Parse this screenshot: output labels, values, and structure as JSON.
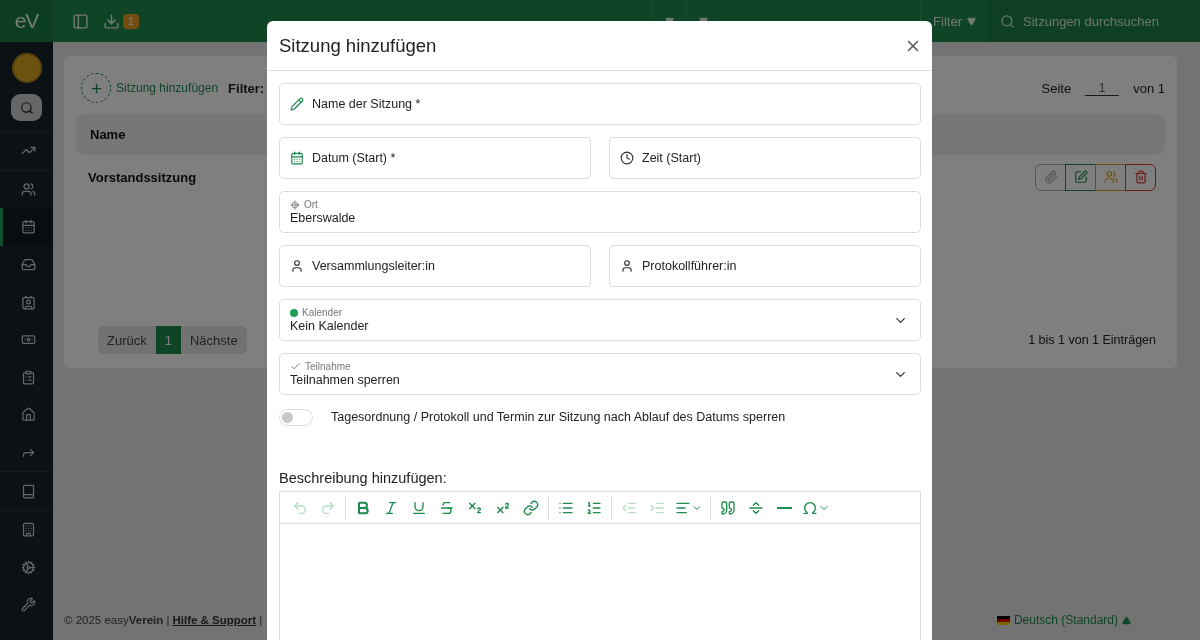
{
  "sidebar": {
    "logo": "eV",
    "items": [
      {
        "kind": "chart",
        "selected": false
      },
      {
        "kind": "users",
        "selected": false
      },
      {
        "kind": "calendar",
        "selected": true
      },
      {
        "kind": "inbox",
        "selected": false
      },
      {
        "kind": "contact",
        "selected": false
      },
      {
        "kind": "money",
        "selected": false
      },
      {
        "kind": "clipboard",
        "selected": false
      },
      {
        "kind": "home",
        "selected": false
      },
      {
        "kind": "share",
        "selected": false
      },
      {
        "kind": "book",
        "selected": false
      },
      {
        "kind": "building",
        "selected": false
      },
      {
        "kind": "cogs",
        "selected": false
      },
      {
        "kind": "wrench",
        "selected": false
      }
    ]
  },
  "topbar": {
    "badge": "1",
    "menus": [
      {
        "kind": "dropdown"
      },
      {
        "kind": "dropdown"
      },
      {
        "kind": "dropdown",
        "label": "Filter"
      }
    ],
    "search": {
      "placeholder": "Sitzungen durchsuchen"
    }
  },
  "page": {
    "add_label": "Sitzung hinzufügen",
    "filter_label": "Filter:",
    "page_label": "Seite",
    "page_value": "1",
    "page_of": "von 1",
    "table": {
      "columns": [
        "Name"
      ],
      "rows": [
        {
          "name": "Vorstandssitzung",
          "actions": [
            {
              "kind": "attach"
            },
            {
              "kind": "edit"
            },
            {
              "kind": "group"
            },
            {
              "kind": "delete"
            }
          ]
        }
      ]
    },
    "pager": [
      {
        "label": "Zurück",
        "selected": false
      },
      {
        "label": "1",
        "selected": true
      },
      {
        "label": "Nächste",
        "selected": false
      }
    ],
    "info": "1 bis 1 von 1 Einträgen"
  },
  "footer": {
    "copyright": "© 2025 easy**Verein** |",
    "link": "Hilfe & Support",
    "separator": "|",
    "language": "Deutsch (Standard)"
  },
  "modal": {
    "title": "Sitzung hinzufügen",
    "rows": [
      {
        "fields": [
          {
            "kind": "name",
            "placeholder": "Name der Sitzung *"
          }
        ]
      },
      {
        "fields": [
          {
            "kind": "date",
            "placeholder": "Datum (Start) *"
          },
          {
            "kind": "time",
            "placeholder": "Zeit (Start)"
          }
        ]
      },
      {
        "fields": [
          {
            "kind": "place",
            "label": "Ort",
            "value": "Eberswalde"
          }
        ]
      },
      {
        "fields": [
          {
            "kind": "person",
            "placeholder": "Versammlungsleiter:in"
          },
          {
            "kind": "person",
            "placeholder": "Protokollführer:in"
          }
        ]
      },
      {
        "fields": [
          {
            "kind": "calendar-select",
            "label": "Kalender",
            "value": "Kein Kalender",
            "color": "#1f9d57"
          }
        ]
      },
      {
        "fields": [
          {
            "kind": "check-select",
            "label": "Teilnahme",
            "value": "Teilnahmen sperren"
          }
        ]
      }
    ],
    "toggle": {
      "on": false,
      "label": "Tagesordnung / Protokoll und Termin zur Sitzung nach Ablauf des Datums sperren"
    },
    "description_label": "Beschreibung hinzufügen:",
    "toolbar": [
      {
        "kind": "undo",
        "disabled": true
      },
      {
        "kind": "redo",
        "disabled": true
      },
      {
        "kind": "sep"
      },
      {
        "kind": "bold",
        "disabled": false
      },
      {
        "kind": "italic",
        "disabled": false
      },
      {
        "kind": "underline",
        "disabled": false
      },
      {
        "kind": "strike",
        "disabled": false
      },
      {
        "kind": "sub",
        "disabled": false
      },
      {
        "kind": "sup",
        "disabled": false
      },
      {
        "kind": "link",
        "disabled": false
      },
      {
        "kind": "sep"
      },
      {
        "kind": "bullets",
        "disabled": false
      },
      {
        "kind": "numbers",
        "disabled": false
      },
      {
        "kind": "sep"
      },
      {
        "kind": "outdent",
        "disabled": true
      },
      {
        "kind": "indent",
        "disabled": true
      },
      {
        "kind": "align",
        "disabled": false
      },
      {
        "kind": "sep"
      },
      {
        "kind": "quote",
        "disabled": false
      },
      {
        "kind": "pagebreak",
        "disabled": false
      },
      {
        "kind": "rule",
        "disabled": false
      },
      {
        "kind": "omega",
        "disabled": false
      }
    ]
  }
}
